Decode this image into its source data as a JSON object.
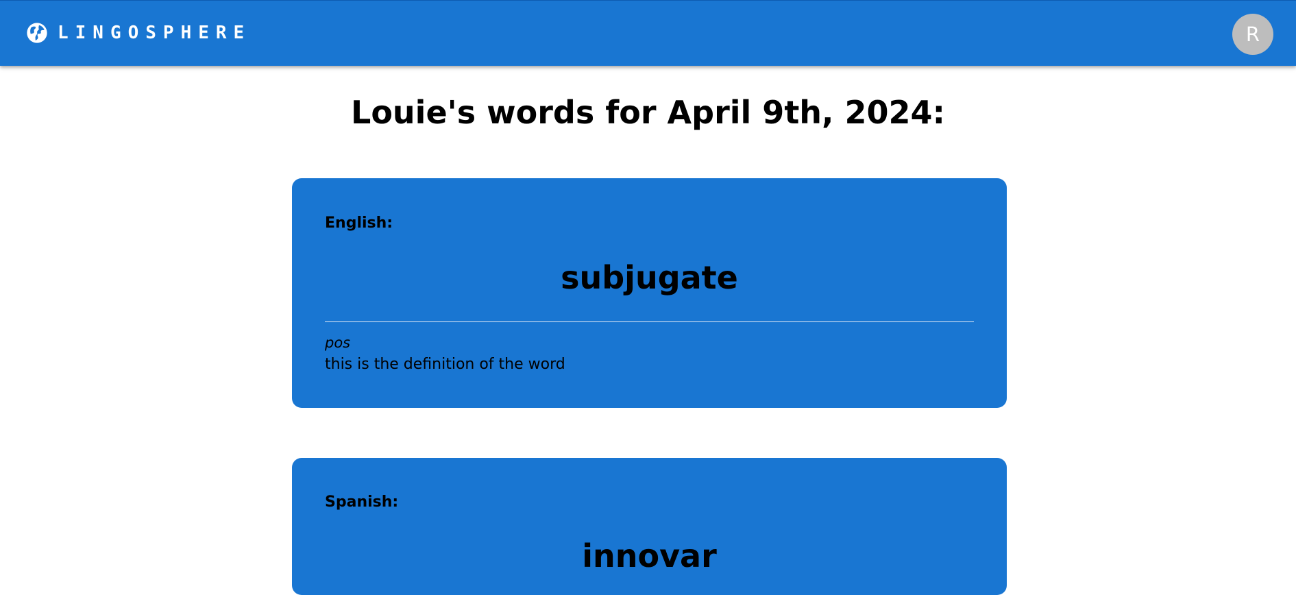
{
  "header": {
    "app_name": "LINGOSPHERE",
    "logo_icon": "globe-icon",
    "avatar_initial": "R",
    "brand_color": "#1976d2",
    "avatar_color": "#bdbdbd"
  },
  "main": {
    "title": "Louie's words for April 9th, 2024:"
  },
  "cards": [
    {
      "language": "English:",
      "word": "subjugate",
      "pos": "pos",
      "definition": "this is the definition of the word"
    },
    {
      "language": "Spanish:",
      "word": "innovar"
    }
  ]
}
